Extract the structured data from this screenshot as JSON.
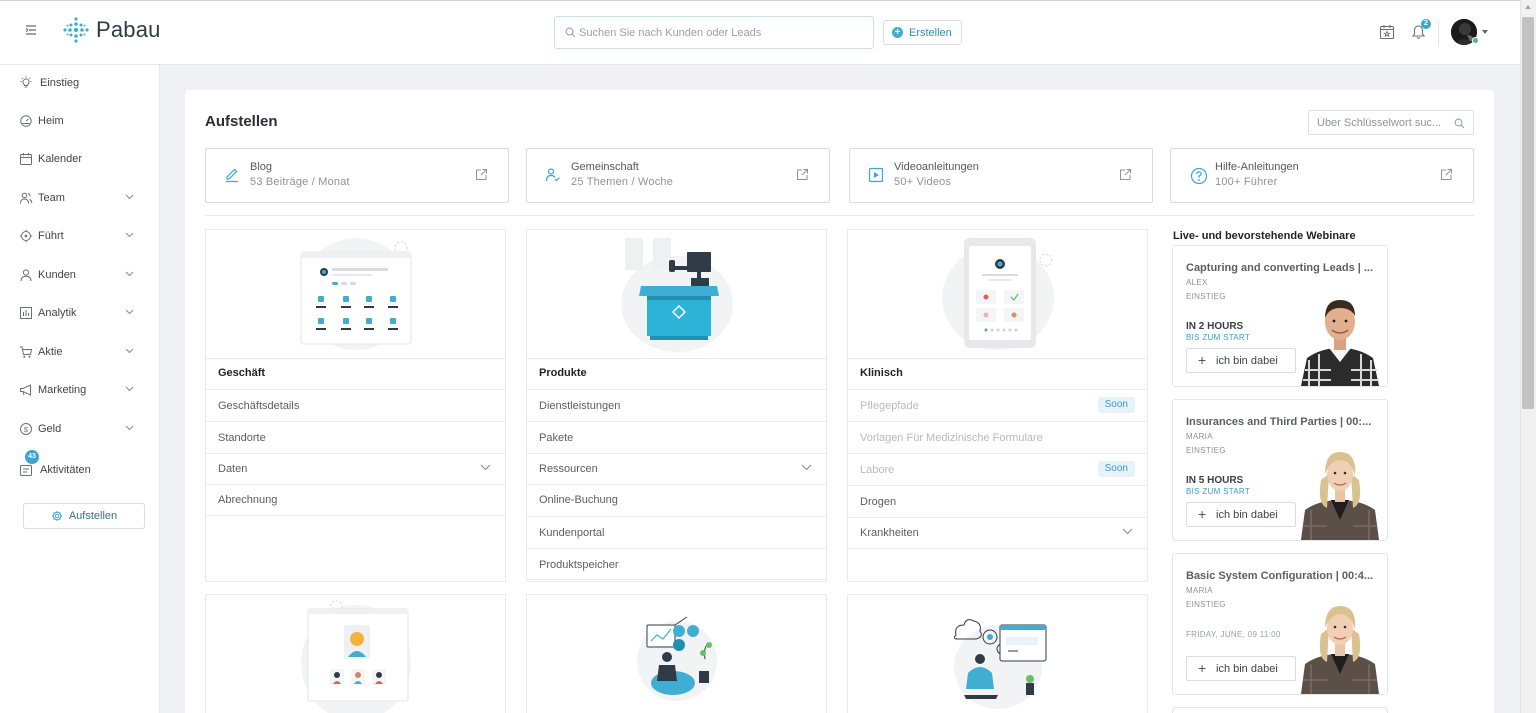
{
  "app": {
    "logo_text": "Pabau"
  },
  "topbar": {
    "search_placeholder": "Suchen Sie nach Kunden oder Leads",
    "create_label": "Erstellen",
    "notification_count": "2"
  },
  "sidebar": {
    "items": [
      {
        "label": "Einstieg",
        "icon": "lightbulb-icon",
        "expandable": false
      },
      {
        "label": "Heim",
        "icon": "dashboard-icon",
        "expandable": false
      },
      {
        "label": "Kalender",
        "icon": "calendar-icon",
        "expandable": false
      },
      {
        "label": "Team",
        "icon": "team-icon",
        "expandable": true
      },
      {
        "label": "Führt",
        "icon": "target-icon",
        "expandable": true
      },
      {
        "label": "Kunden",
        "icon": "user-icon",
        "expandable": true
      },
      {
        "label": "Analytik",
        "icon": "chart-icon",
        "expandable": true
      },
      {
        "label": "Aktie",
        "icon": "cart-icon",
        "expandable": true
      },
      {
        "label": "Marketing",
        "icon": "megaphone-icon",
        "expandable": true
      },
      {
        "label": "Geld",
        "icon": "money-icon",
        "expandable": true
      },
      {
        "label": "Aktivitäten",
        "icon": "activities-icon",
        "expandable": false,
        "badge": "43"
      }
    ],
    "setup_label": "Aufstellen"
  },
  "page": {
    "title": "Aufstellen",
    "keyword_search_placeholder": "Über Schlüsselwort suc..."
  },
  "resources": [
    {
      "title": "Blog",
      "subtitle": "53 Beiträge / Monat",
      "icon": "pen-icon"
    },
    {
      "title": "Gemeinschaft",
      "subtitle": "25 Themen / Woche",
      "icon": "community-icon"
    },
    {
      "title": "Videoanleitungen",
      "subtitle": "50+ Videos",
      "icon": "video-icon"
    },
    {
      "title": "Hilfe-Anleitungen",
      "subtitle": "100+ Führer",
      "icon": "help-icon"
    }
  ],
  "modules": [
    {
      "title": "Geschäft",
      "rows": [
        {
          "label": "Geschäftsdetails"
        },
        {
          "label": "Standorte"
        },
        {
          "label": "Daten",
          "expandable": true
        },
        {
          "label": "Abrechnung"
        }
      ]
    },
    {
      "title": "Produkte",
      "rows": [
        {
          "label": "Dienstleistungen"
        },
        {
          "label": "Pakete"
        },
        {
          "label": "Ressourcen",
          "expandable": true
        },
        {
          "label": "Online-Buchung"
        },
        {
          "label": "Kundenportal"
        },
        {
          "label": "Produktspeicher"
        }
      ]
    },
    {
      "title": "Klinisch",
      "rows": [
        {
          "label": "Pflegepfade",
          "disabled": true,
          "badge": "Soon"
        },
        {
          "label": "Vorlagen Für Medizinische Formulare",
          "disabled": true
        },
        {
          "label": "Labore",
          "disabled": true,
          "badge": "Soon"
        },
        {
          "label": "Drogen"
        },
        {
          "label": "Krankheiten",
          "expandable": true
        }
      ]
    }
  ],
  "webinars": {
    "heading": "Live- und bevorstehende Webinare",
    "items": [
      {
        "title": "Capturing and converting Leads | ...",
        "presenter": "ALEX",
        "category": "EINSTIEG",
        "time": "IN 2 HOURS",
        "time_sub": "BIS ZUM START",
        "join_label": "ich bin dabei"
      },
      {
        "title": "Insurances and Third Parties | 00:...",
        "presenter": "MARIA",
        "category": "EINSTIEG",
        "time": "IN 5 HOURS",
        "time_sub": "BIS ZUM START",
        "join_label": "ich bin dabei"
      },
      {
        "title": "Basic System Configuration | 00:4...",
        "presenter": "MARIA",
        "category": "EINSTIEG",
        "date": "FRIDAY, JUNE, 09 11:00",
        "join_label": "ich bin dabei"
      }
    ]
  },
  "colors": {
    "accent": "#3ca6d1",
    "background": "#eff1f5",
    "soon_bg": "#e7f3f9"
  }
}
